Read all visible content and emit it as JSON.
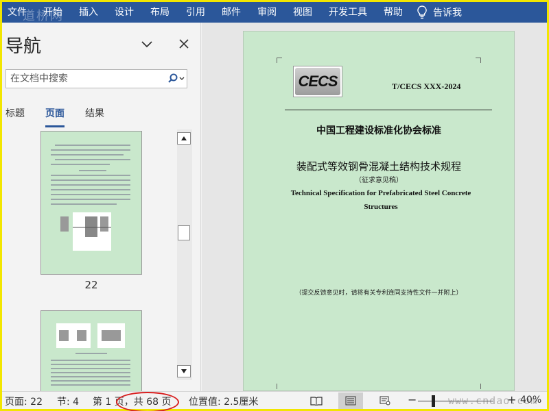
{
  "ribbon": {
    "tabs": [
      "文件",
      "开始",
      "插入",
      "设计",
      "布局",
      "引用",
      "邮件",
      "审阅",
      "视图",
      "开发工具",
      "帮助"
    ],
    "tell_me": "告诉我",
    "tell_me_icon": "lightbulb-icon",
    "bg_color": "#2b579a"
  },
  "nav": {
    "title": "导航",
    "search_placeholder": "在文档中搜索",
    "tabs": [
      "标题",
      "页面",
      "结果"
    ],
    "active_tab": "页面",
    "thumbnail_label": "22"
  },
  "document": {
    "std_code": "T/CECS XXX-2024",
    "logo_text": "CECS",
    "association": "中国工程建设标准化协会标准",
    "title_cn": "装配式等效钢骨混凝土结构技术规程",
    "draft_note": "（征求意见稿）",
    "title_en": "Technical Specification for Prefabricated Steel Concrete Structures",
    "feedback_note": "（提交反馈意见时，请将有关专利连同支持性文件一并附上）",
    "page_color": "#c9e8cc"
  },
  "status": {
    "page": "页面: 22",
    "section": "节: 4",
    "page_of": "第 1 页，共 68 页",
    "position": "位置值: 2.5厘米",
    "zoom_minus": "−",
    "zoom_plus": "+",
    "zoom": "40%",
    "highlight_color": "#d81e1e"
  },
  "watermarks": {
    "top_left": "道桥网",
    "bottom_right": "www.cndao.com"
  }
}
